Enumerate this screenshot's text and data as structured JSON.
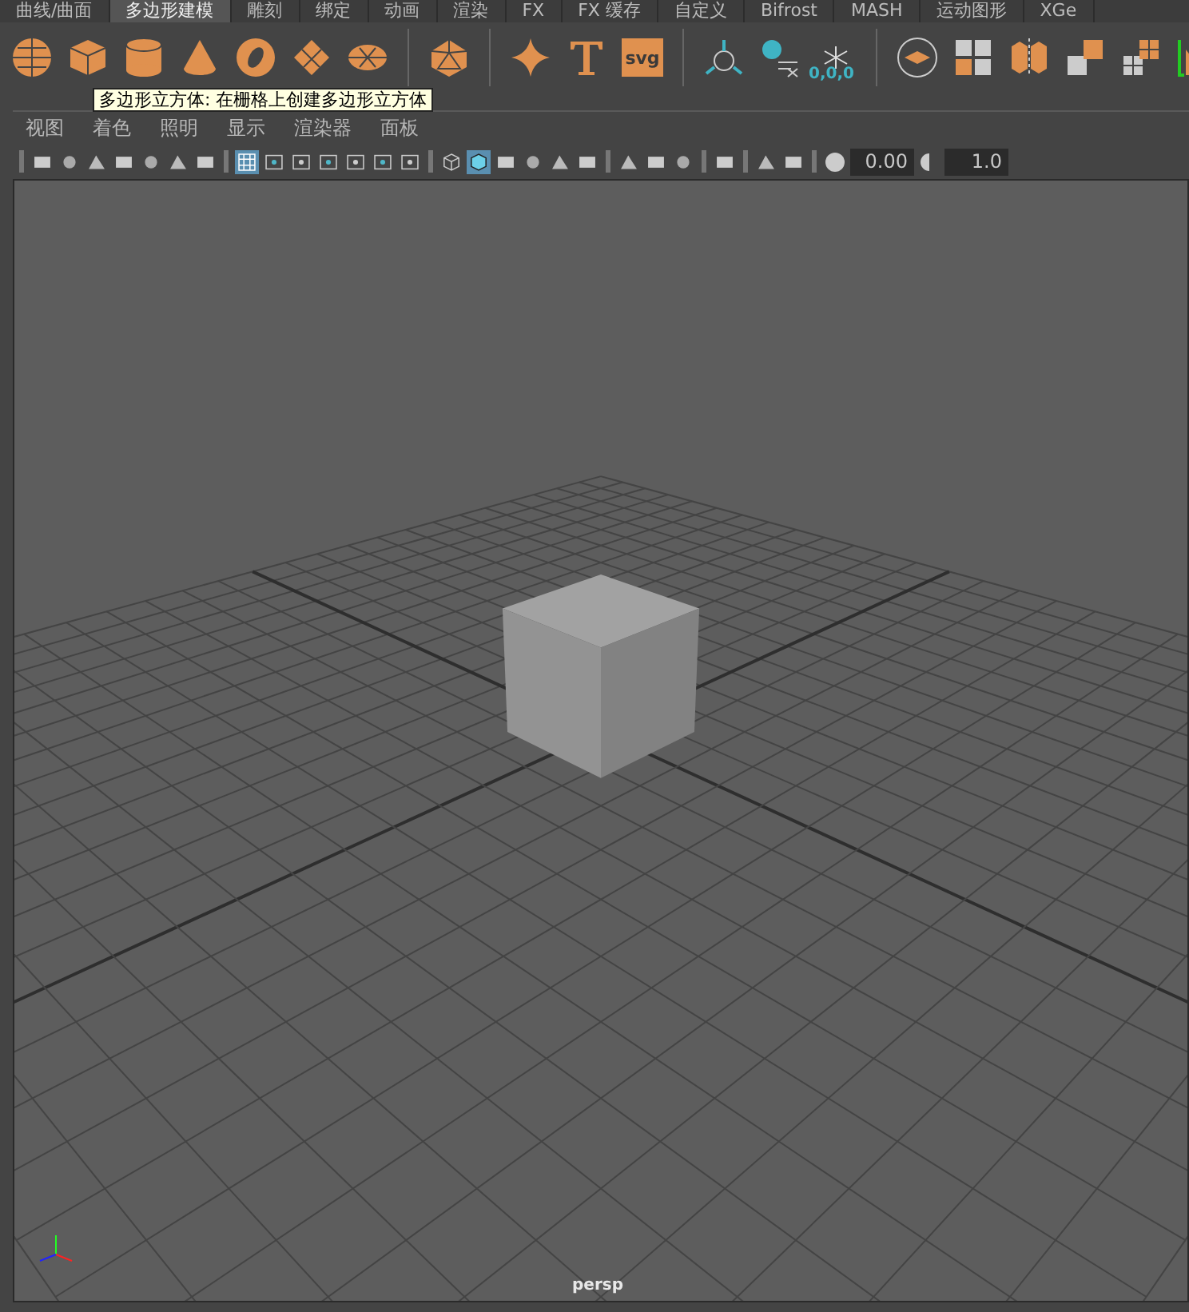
{
  "shelf_tabs": [
    {
      "label": "曲线/曲面",
      "selected": false
    },
    {
      "label": "多边形建模",
      "selected": true
    },
    {
      "label": "雕刻",
      "selected": false
    },
    {
      "label": "绑定",
      "selected": false
    },
    {
      "label": "动画",
      "selected": false
    },
    {
      "label": "渲染",
      "selected": false
    },
    {
      "label": "FX",
      "selected": false
    },
    {
      "label": "FX 缓存",
      "selected": false
    },
    {
      "label": "自定义",
      "selected": false
    },
    {
      "label": "Bifrost",
      "selected": false
    },
    {
      "label": "MASH",
      "selected": false
    },
    {
      "label": "运动图形",
      "selected": false
    },
    {
      "label": "XGe",
      "selected": false
    }
  ],
  "shelf": {
    "svg_label": "svg",
    "snap_label": "0,0,0"
  },
  "tooltip": "多边形立方体: 在栅格上创建多边形立方体",
  "panel": {
    "menus": [
      "视图",
      "着色",
      "照明",
      "显示",
      "渲染器",
      "面板"
    ],
    "exposure": "0.00",
    "gamma": "1.0",
    "camera_label": "persp"
  }
}
